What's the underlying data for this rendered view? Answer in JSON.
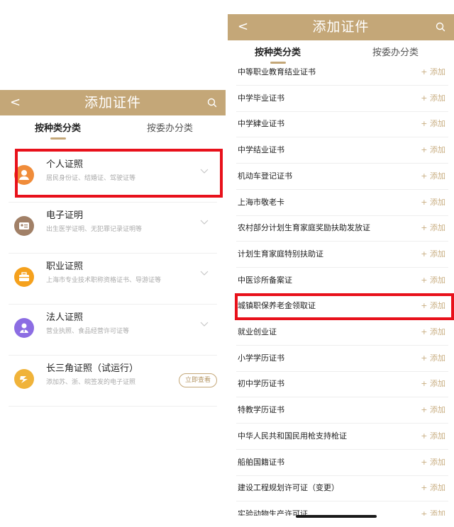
{
  "left": {
    "header": {
      "back": "<",
      "title": "添加证件"
    },
    "tabs": [
      {
        "label": "按种类分类"
      },
      {
        "label": "按委办分类"
      }
    ],
    "categories": [
      {
        "name": "个人证照",
        "desc": "居民身份证、结婚证、驾驶证等",
        "icon": "person-icon",
        "color": "#f08c3a"
      },
      {
        "name": "电子证明",
        "desc": "出生医学证明、无犯罪记录证明等",
        "icon": "id-card-icon",
        "color": "#a18067"
      },
      {
        "name": "职业证照",
        "desc": "上海市专业技术职称资格证书、导游证等",
        "icon": "briefcase-icon",
        "color": "#f5a11d"
      },
      {
        "name": "法人证照",
        "desc": "营业执照、食品经营许可证等",
        "icon": "legal-person-icon",
        "color": "#8c6de3"
      },
      {
        "name": "长三角证照（试运行）",
        "desc": "添加苏、浙、皖签发的电子证照",
        "icon": "yangtze-icon",
        "color": "#f0b33a",
        "button": "立即查看"
      }
    ]
  },
  "right": {
    "header": {
      "back": "<",
      "title": "添加证件"
    },
    "tabs": [
      {
        "label": "按种类分类"
      },
      {
        "label": "按委办分类"
      }
    ],
    "add_label": "+ 添加",
    "items": [
      "中等职业教育结业证书",
      "中学毕业证书",
      "中学肄业证书",
      "中学结业证书",
      "机动车登记证书",
      "上海市敬老卡",
      "农村部分计划生育家庭奖励扶助发放证",
      "计划生育家庭特别扶助证",
      "中医诊所备案证",
      "城镇职保养老金领取证",
      "就业创业证",
      "小学学历证书",
      "初中学历证书",
      "特教学历证书",
      "中华人民共和国民用枪支持枪证",
      "船舶国籍证书",
      "建设工程规划许可证（变更）",
      "实验动物生产许可证"
    ]
  },
  "colors": {
    "header_bg": "#c4a778",
    "highlight": "#e8111b",
    "add_text": "#c8ad80"
  }
}
